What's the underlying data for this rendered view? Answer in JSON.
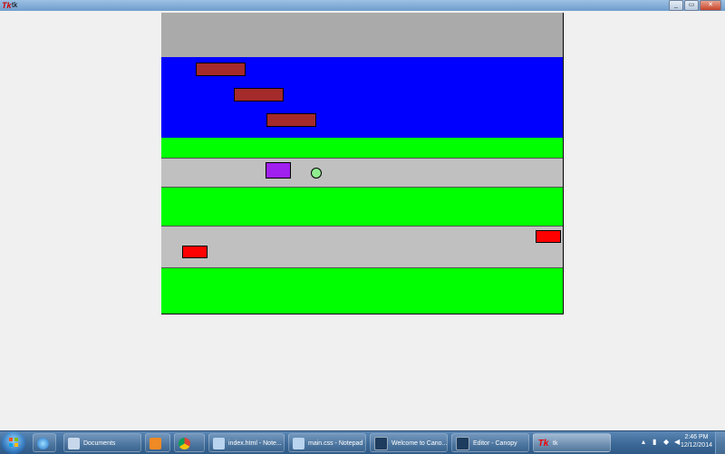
{
  "window": {
    "title": "tk",
    "controls": [
      "_",
      "▭",
      "✕"
    ]
  },
  "game": {
    "zones": [
      "top-bank",
      "water",
      "safe-strip-1",
      "road-1",
      "safe-strip-2",
      "road-2",
      "start-grass"
    ],
    "logs_color": "#a52a2a",
    "water_color": "#0000ff",
    "grass_color": "#00ff00",
    "road_color": "#c0c0c0",
    "bank_color": "#aaaaaa",
    "purple_car_color": "#a020f0",
    "red_car_color": "#ff0000",
    "player_color": "#90ee90",
    "log_count": 3,
    "car_count": 3
  },
  "taskbar": {
    "items": [
      {
        "label": "Documents",
        "icon": "documents-icon"
      },
      {
        "label": "",
        "icon": "media-player-icon"
      },
      {
        "label": "",
        "icon": "chrome-icon"
      },
      {
        "label": "index.html - Note...",
        "icon": "notepad-icon"
      },
      {
        "label": "main.css - Notepad",
        "icon": "notepad-icon"
      },
      {
        "label": "Welcome to Cano...",
        "icon": "canopy-icon"
      },
      {
        "label": "Editor - Canopy",
        "icon": "canopy-icon"
      },
      {
        "label": "tk",
        "icon": "tk-icon"
      }
    ],
    "clock_time": "2:46 PM",
    "clock_date": "12/12/2014"
  }
}
